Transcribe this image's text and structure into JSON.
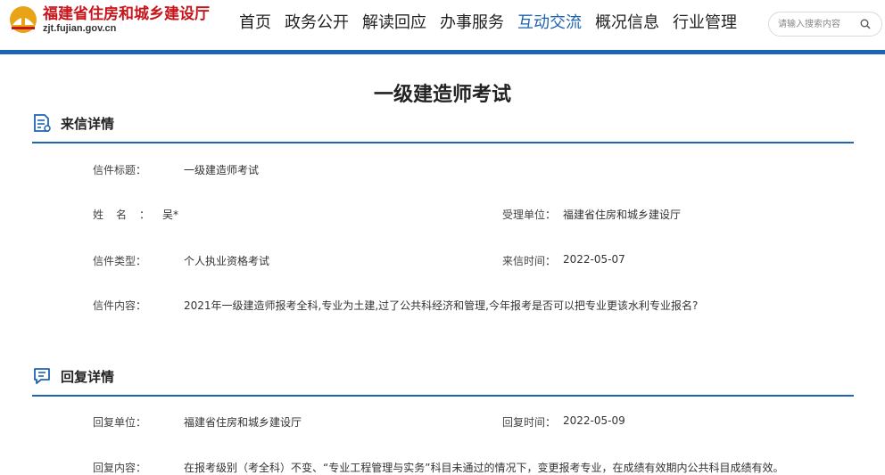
{
  "header": {
    "site_title": "福建省住房和城乡建设厅",
    "site_domain": "zjt.fujian.gov.cn",
    "nav": [
      {
        "label": "首页",
        "active": false
      },
      {
        "label": "政务公开",
        "active": false
      },
      {
        "label": "解读回应",
        "active": false
      },
      {
        "label": "办事服务",
        "active": false
      },
      {
        "label": "互动交流",
        "active": true
      },
      {
        "label": "概况信息",
        "active": false
      },
      {
        "label": "行业管理",
        "active": false
      }
    ],
    "search_placeholder": "请输入搜索内容",
    "search_icon": "search-icon"
  },
  "page_title": "一级建造师考试",
  "letter": {
    "section_title": "来信详情",
    "section_icon": "document-list-icon",
    "subject_label": "信件标题",
    "subject_value": "一级建造师考试",
    "name_label": "姓名",
    "name_value": "吴*",
    "dept_label": "受理单位",
    "dept_value": "福建省住房和城乡建设厅",
    "type_label": "信件类型",
    "type_value": "个人执业资格考试",
    "date_label": "来信时间",
    "date_value": "2022-05-07",
    "content_label": "信件内容",
    "content_value": "2021年一级建造师报考全科,专业为土建,过了公共科经济和管理,今年报考是否可以把专业更该水利专业报名?"
  },
  "reply": {
    "section_title": "回复详情",
    "section_icon": "chat-reply-icon",
    "unit_label": "回复单位",
    "unit_value": "福建省住房和城乡建设厅",
    "date_label": "回复时间",
    "date_value": "2022-05-09",
    "content_label": "回复内容",
    "content_value": "在报考级别（考全科）不变、“专业工程管理与实务”科目未通过的情况下，变更报考专业，在成绩有效期内公共科目成绩有效。"
  },
  "colon": "：",
  "colors": {
    "accent": "#1e64b4",
    "brand_red": "#c8151b",
    "logo_gold": "#e8a317"
  }
}
